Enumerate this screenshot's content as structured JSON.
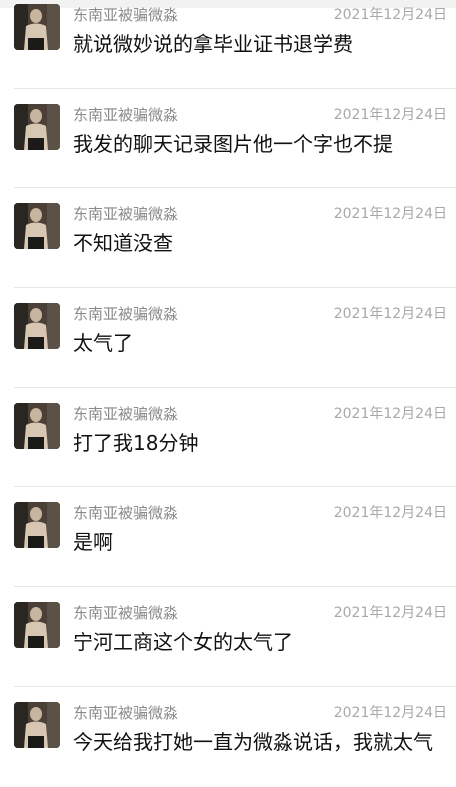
{
  "comments": [
    {
      "name": "东南亚被骗微淼",
      "date": "2021年12月24日",
      "text": "就说微妙说的拿毕业证书退学费"
    },
    {
      "name": "东南亚被骗微淼",
      "date": "2021年12月24日",
      "text": "我发的聊天记录图片他一个字也不提"
    },
    {
      "name": "东南亚被骗微淼",
      "date": "2021年12月24日",
      "text": "不知道没查"
    },
    {
      "name": "东南亚被骗微淼",
      "date": "2021年12月24日",
      "text": "太气了"
    },
    {
      "name": "东南亚被骗微淼",
      "date": "2021年12月24日",
      "text": "打了我18分钟"
    },
    {
      "name": "东南亚被骗微淼",
      "date": "2021年12月24日",
      "text": "是啊"
    },
    {
      "name": "东南亚被骗微淼",
      "date": "2021年12月24日",
      "text": "宁河工商这个女的太气了"
    },
    {
      "name": "东南亚被骗微淼",
      "date": "2021年12月24日",
      "text": "今天给我打她一直为微淼说话，我就太气"
    }
  ],
  "avatar_icon": "avatar-photo-icon",
  "colors": {
    "name": "#8a8a8a",
    "date": "#a8a8a8",
    "message": "#111111",
    "divider": "#e6e6e6"
  }
}
